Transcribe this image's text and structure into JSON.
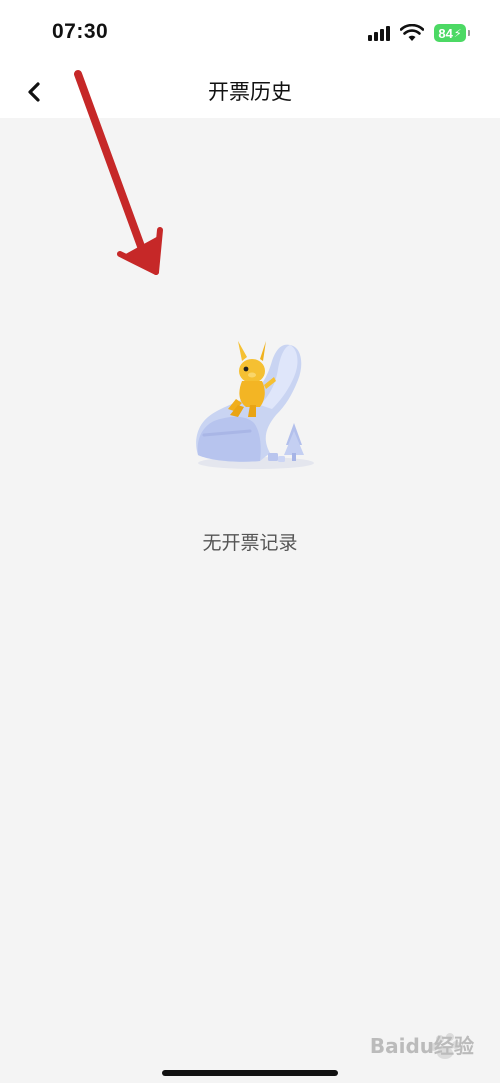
{
  "status_bar": {
    "time": "07:30",
    "battery_level": "84",
    "battery_color": "#4cd964",
    "signal_icon": "cellular-signal-icon",
    "wifi_icon": "wifi-icon",
    "charging_icon": "lightning-bolt-icon"
  },
  "nav": {
    "back_icon": "chevron-left-icon",
    "title": "开票历史"
  },
  "empty_state": {
    "illustration": "empty-box-dog-illustration",
    "message": "无开票记录"
  },
  "annotation": {
    "icon": "red-arrow-icon",
    "color": "#c62828"
  },
  "watermark": {
    "text": "Baidu经验"
  }
}
